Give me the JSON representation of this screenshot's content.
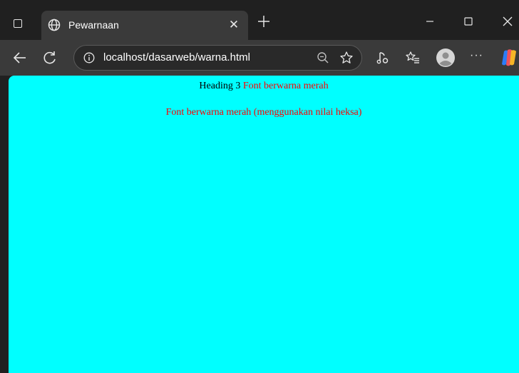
{
  "browser": {
    "tab": {
      "title": "Pewarnaan"
    },
    "address_bar": {
      "url": "localhost/dasarweb/warna.html"
    },
    "icons": {
      "sidebar": "sidebar-toggle-icon",
      "globe": "globe-icon",
      "close": "close-icon",
      "new_tab": "plus-icon",
      "minimize": "minimize-icon",
      "maximize": "maximize-icon",
      "back": "back-arrow-icon",
      "refresh": "refresh-icon",
      "info": "info-icon",
      "zoom": "zoom-out-icon",
      "favorite": "star-icon",
      "read_aloud": "read-aloud-icon",
      "favorites": "favorites-icon",
      "profile": "profile-icon",
      "more": "more-icon",
      "copilot": "copilot-icon"
    },
    "more_label": "···",
    "close_label": "✕"
  },
  "page": {
    "background": "#00ffff",
    "heading_text": "Heading 3",
    "heading_red_text": "Font berwarna merah",
    "paragraph_red_text": "Font berwarna merah (menggunakan nilai heksa)",
    "red_color": "#ff0000"
  }
}
